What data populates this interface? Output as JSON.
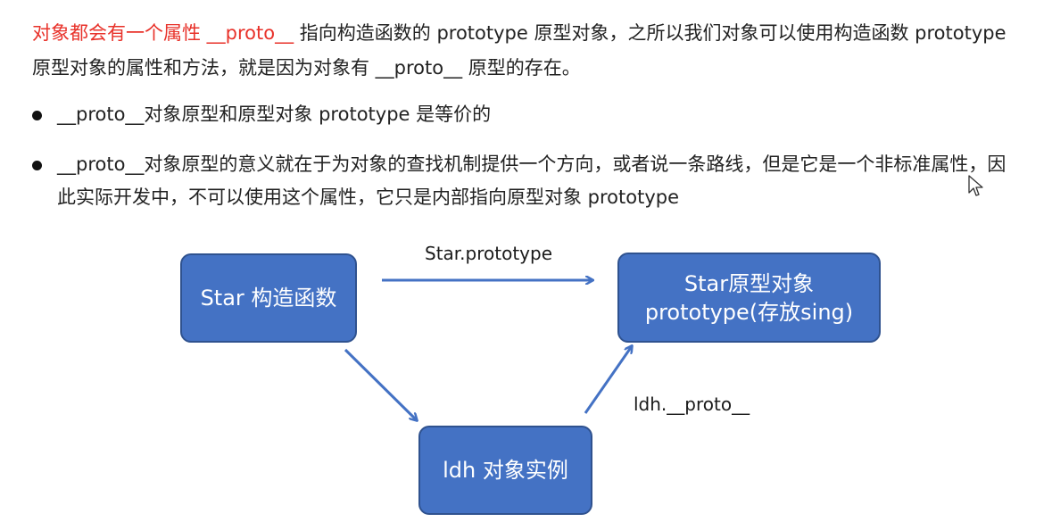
{
  "intro": {
    "highlight": "对象都会有一个属性 __proto__",
    "rest": " 指向构造函数的 prototype 原型对象，之所以我们对象可以使用构造函数 prototype 原型对象的属性和方法，就是因为对象有 __proto__ 原型的存在。"
  },
  "bullets": [
    "__proto__对象原型和原型对象 prototype 是等价的",
    "__proto__对象原型的意义就在于为对象的查找机制提供一个方向，或者说一条路线，但是它是一个非标准属性，因此实际开发中，不可以使用这个属性，它只是内部指向原型对象 prototype"
  ],
  "diagram": {
    "nodes": {
      "constructor": "Star 构造函数",
      "prototype": "Star原型对象 prototype(存放sing)",
      "instance": "ldh 对象实例"
    },
    "edges": {
      "constructor_to_prototype": "Star.prototype",
      "instance_to_prototype": "ldh.__proto__"
    }
  },
  "colors": {
    "highlight": "#e8322a",
    "node_fill": "#4472c4",
    "arrow": "#4472c4"
  }
}
